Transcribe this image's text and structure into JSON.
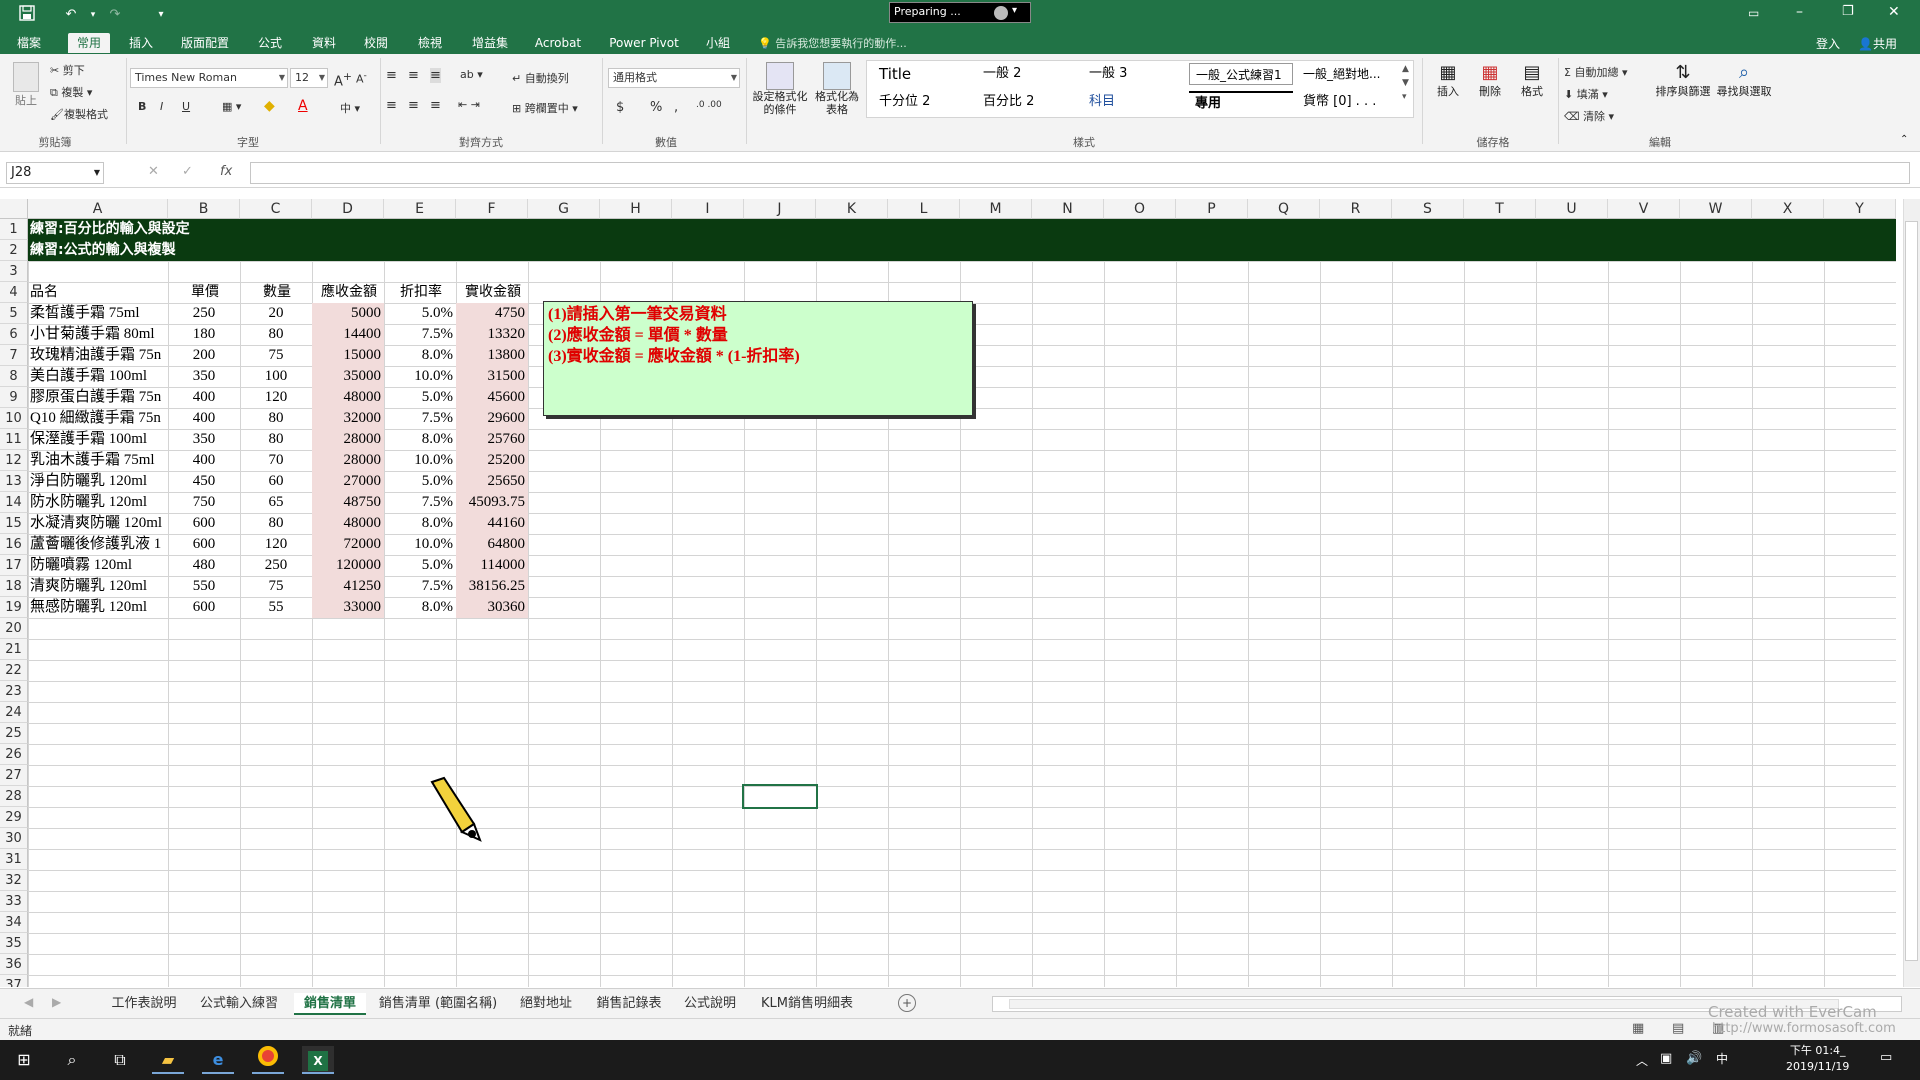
{
  "window": {
    "preparing_label": "Preparing ...",
    "save_icon": "save-icon",
    "undo_icon": "undo-icon",
    "redo_icon": "redo-icon",
    "customize_icon": "customize-qat-icon"
  },
  "ribbon_tabs": [
    {
      "label": "檔案"
    },
    {
      "label": "常用"
    },
    {
      "label": "插入"
    },
    {
      "label": "版面配置"
    },
    {
      "label": "公式"
    },
    {
      "label": "資料"
    },
    {
      "label": "校閱"
    },
    {
      "label": "檢視"
    },
    {
      "label": "增益集"
    },
    {
      "label": "Acrobat"
    },
    {
      "label": "Power Pivot"
    },
    {
      "label": "小組"
    }
  ],
  "tell_me": "告訴我您想要執行的動作...",
  "signin": "登入",
  "share": "共用",
  "ribbon": {
    "paste": "貼上",
    "cut": "剪下",
    "copy": "複製",
    "format_painter": "複製格式",
    "group_clipboard": "剪貼簿",
    "font_name": "Times New Roman",
    "font_size": "12",
    "bold": "B",
    "italic": "I",
    "underline": "U",
    "group_font": "字型",
    "wrap_text": "自動換列",
    "merge_center": "跨欄置中",
    "group_alignment": "對齊方式",
    "number_format": "通用格式",
    "currency": "$",
    "percent": "%",
    "comma": ",",
    "group_number": "數值",
    "conditional": "設定格式化的條件",
    "format_table": "格式化為表格",
    "styles": [
      {
        "label": "Title"
      },
      {
        "label": "一般 2"
      },
      {
        "label": "一般 3"
      },
      {
        "label": "一般_公式練習1"
      },
      {
        "label": "一般_絕對地..."
      },
      {
        "label": "千分位 2"
      },
      {
        "label": "百分比 2"
      },
      {
        "label": "科目"
      },
      {
        "label": "專用"
      },
      {
        "label": "貨幣 [0] . . ."
      }
    ],
    "group_styles": "樣式",
    "insert": "插入",
    "delete": "刪除",
    "format": "格式",
    "group_cells": "儲存格",
    "autosum": "自動加總",
    "fill": "填滿",
    "clear": "清除",
    "sort_filter": "排序與篩選",
    "find_select": "尋找與選取",
    "group_editing": "編輯"
  },
  "formula_bar": {
    "name_box": "J28",
    "fx": "fx",
    "value": ""
  },
  "columns": [
    "A",
    "B",
    "C",
    "D",
    "E",
    "F",
    "G",
    "H",
    "I",
    "J",
    "K",
    "L",
    "M",
    "N",
    "O",
    "P",
    "Q",
    "R",
    "S",
    "T",
    "U",
    "V",
    "W",
    "X",
    "Y"
  ],
  "rows": [
    "1",
    "2",
    "3",
    "4",
    "5",
    "6",
    "7",
    "8",
    "9",
    "10",
    "11",
    "12",
    "13",
    "14",
    "15",
    "16",
    "17",
    "18",
    "19",
    "20",
    "21",
    "22",
    "23",
    "24",
    "25",
    "26",
    "27",
    "28",
    "29",
    "30",
    "31",
    "32",
    "33",
    "34",
    "35",
    "36",
    "37"
  ],
  "banner": {
    "line1": "練習:百分比的輸入與設定",
    "line2": "練習:公式的輸入與複製"
  },
  "table": {
    "headers": [
      "品名",
      "單價",
      "數量",
      "應收金額",
      "折扣率",
      "實收金額"
    ],
    "rows": [
      [
        "柔皙護手霜 75ml",
        "250",
        "20",
        "5000",
        "5.0%",
        "4750"
      ],
      [
        "小甘菊護手霜 80ml",
        "180",
        "80",
        "14400",
        "7.5%",
        "13320"
      ],
      [
        "玫瑰精油護手霜 75n",
        "200",
        "75",
        "15000",
        "8.0%",
        "13800"
      ],
      [
        "美白護手霜 100ml",
        "350",
        "100",
        "35000",
        "10.0%",
        "31500"
      ],
      [
        "膠原蛋白護手霜 75n",
        "400",
        "120",
        "48000",
        "5.0%",
        "45600"
      ],
      [
        "Q10 細緻護手霜 75n",
        "400",
        "80",
        "32000",
        "7.5%",
        "29600"
      ],
      [
        "保溼護手霜 100ml",
        "350",
        "80",
        "28000",
        "8.0%",
        "25760"
      ],
      [
        "乳油木護手霜 75ml",
        "400",
        "70",
        "28000",
        "10.0%",
        "25200"
      ],
      [
        "淨白防曬乳 120ml",
        "450",
        "60",
        "27000",
        "5.0%",
        "25650"
      ],
      [
        "防水防曬乳 120ml",
        "750",
        "65",
        "48750",
        "7.5%",
        "45093.75"
      ],
      [
        "水凝清爽防曬 120ml",
        "600",
        "80",
        "48000",
        "8.0%",
        "44160"
      ],
      [
        "蘆薈曬後修護乳液 1",
        "600",
        "120",
        "72000",
        "10.0%",
        "64800"
      ],
      [
        "防曬噴霧 120ml",
        "480",
        "250",
        "120000",
        "5.0%",
        "114000"
      ],
      [
        "清爽防曬乳 120ml",
        "550",
        "75",
        "41250",
        "7.5%",
        "38156.25"
      ],
      [
        "無感防曬乳 120ml",
        "600",
        "55",
        "33000",
        "8.0%",
        "30360"
      ]
    ]
  },
  "note": {
    "line1": "(1)請插入第一筆交易資料",
    "line2": "(2)應收金額 = 單價 * 數量",
    "line3": "(3)實收金額 = 應收金額 * (1-折扣率)"
  },
  "sheet_tabs": [
    {
      "label": "工作表說明"
    },
    {
      "label": "公式輸入練習"
    },
    {
      "label": "銷售清單"
    },
    {
      "label": "銷售清單 (範圍名稱)"
    },
    {
      "label": "絕對地址"
    },
    {
      "label": "銷售記錄表"
    },
    {
      "label": "公式說明"
    },
    {
      "label": "KLM銷售明細表"
    }
  ],
  "active_sheet": "銷售清單",
  "status": "就緒",
  "watermark": {
    "line1": "Created with EverCam",
    "line2": "http://www.formosasoft.com"
  },
  "clock": {
    "time": "下午 01:4_",
    "date": "2019/11/19"
  },
  "colors": {
    "excel_green": "#217346",
    "banner_green": "#0a3a10",
    "note_fill": "#ccffcc",
    "note_text": "#e00000",
    "pink_fill": "#f2dcdb"
  }
}
